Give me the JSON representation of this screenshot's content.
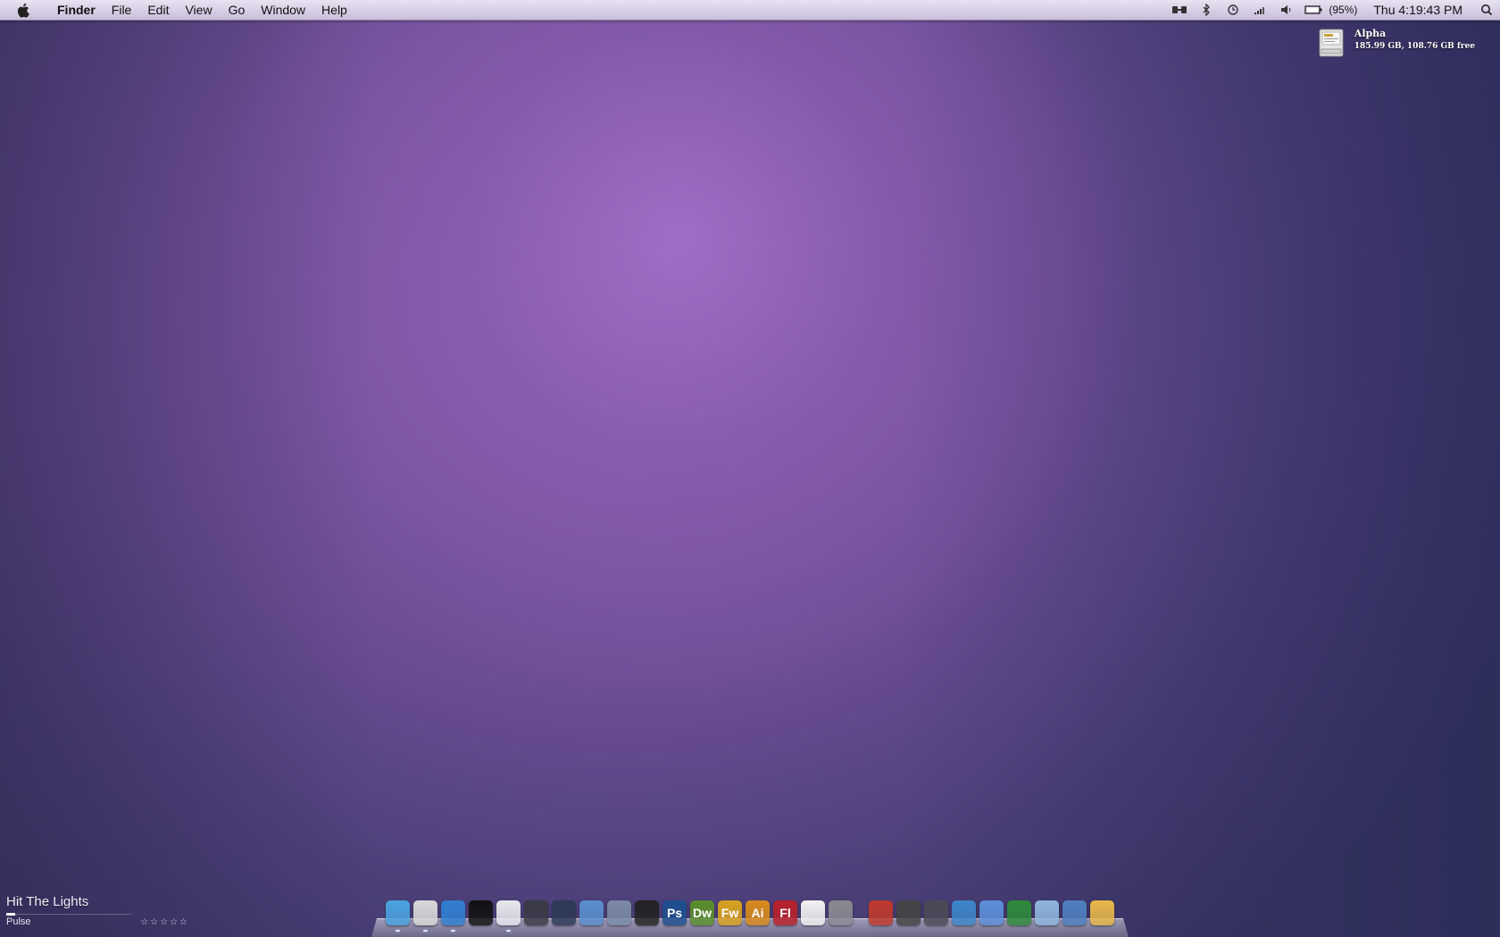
{
  "menubar": {
    "app_name": "Finder",
    "menus": [
      "File",
      "Edit",
      "View",
      "Go",
      "Window",
      "Help"
    ],
    "status_icons": [
      "display-mirroring-icon",
      "bluetooth-icon",
      "time-machine-icon",
      "wifi-icon",
      "volume-icon",
      "battery-icon"
    ],
    "battery_percent": "(95%)",
    "clock": "Thu 4:19:43 PM"
  },
  "drive": {
    "name": "Alpha",
    "info": "185.99 GB, 108.76 GB free"
  },
  "now_playing": {
    "title": "Hit The Lights",
    "artist": "Pulse",
    "rating_stars": "☆☆☆☆☆",
    "progress": 0.07
  },
  "dock": {
    "items": [
      {
        "name": "finder-icon",
        "label": "",
        "color": "#4aa3df"
      },
      {
        "name": "mail-icon",
        "label": "",
        "color": "#d9d9d9"
      },
      {
        "name": "safari-icon",
        "label": "",
        "color": "#2f7fd0"
      },
      {
        "name": "tuxedo-icon",
        "label": "",
        "color": "#111111"
      },
      {
        "name": "headphones-icon",
        "label": "",
        "color": "#e8e8ee"
      },
      {
        "name": "camera-icon",
        "label": "",
        "color": "#3a3a44"
      },
      {
        "name": "lens-icon",
        "label": "",
        "color": "#2c3a55"
      },
      {
        "name": "chart-app-icon",
        "label": "",
        "color": "#5a8ed0"
      },
      {
        "name": "pen-tablet-icon",
        "label": "",
        "color": "#7a8aa6"
      },
      {
        "name": "notebook-icon",
        "label": "",
        "color": "#222222"
      },
      {
        "name": "photoshop-icon",
        "label": "Ps",
        "color": "#1d4e8f"
      },
      {
        "name": "dreamweaver-icon",
        "label": "Dw",
        "color": "#5b8f2b"
      },
      {
        "name": "fireworks-icon",
        "label": "Fw",
        "color": "#d9a21f"
      },
      {
        "name": "illustrator-icon",
        "label": "Ai",
        "color": "#d98a1c"
      },
      {
        "name": "flash-icon",
        "label": "Fl",
        "color": "#b8202a"
      },
      {
        "name": "acrobat-icon",
        "label": "",
        "color": "#f2f2f2"
      },
      {
        "name": "system-preferences-icon",
        "label": "",
        "color": "#8a8a92"
      },
      {
        "name": "apple-logo-icon",
        "label": "",
        "color": "#c0392b"
      },
      {
        "name": "xcode-icon",
        "label": "",
        "color": "#444444"
      },
      {
        "name": "image-capture-icon",
        "label": "",
        "color": "#4a4a55"
      },
      {
        "name": "utilities-icon",
        "label": "",
        "color": "#3c86c9"
      },
      {
        "name": "applications-folder-icon",
        "label": "",
        "color": "#5c8fd8"
      },
      {
        "name": "money-icon",
        "label": "",
        "color": "#2e8b3a"
      },
      {
        "name": "downloads-folder-icon",
        "label": "",
        "color": "#8fb6dd"
      },
      {
        "name": "documents-icon",
        "label": "",
        "color": "#4f7fc0"
      },
      {
        "name": "trash-icon",
        "label": "",
        "color": "#e8b84a"
      }
    ]
  }
}
